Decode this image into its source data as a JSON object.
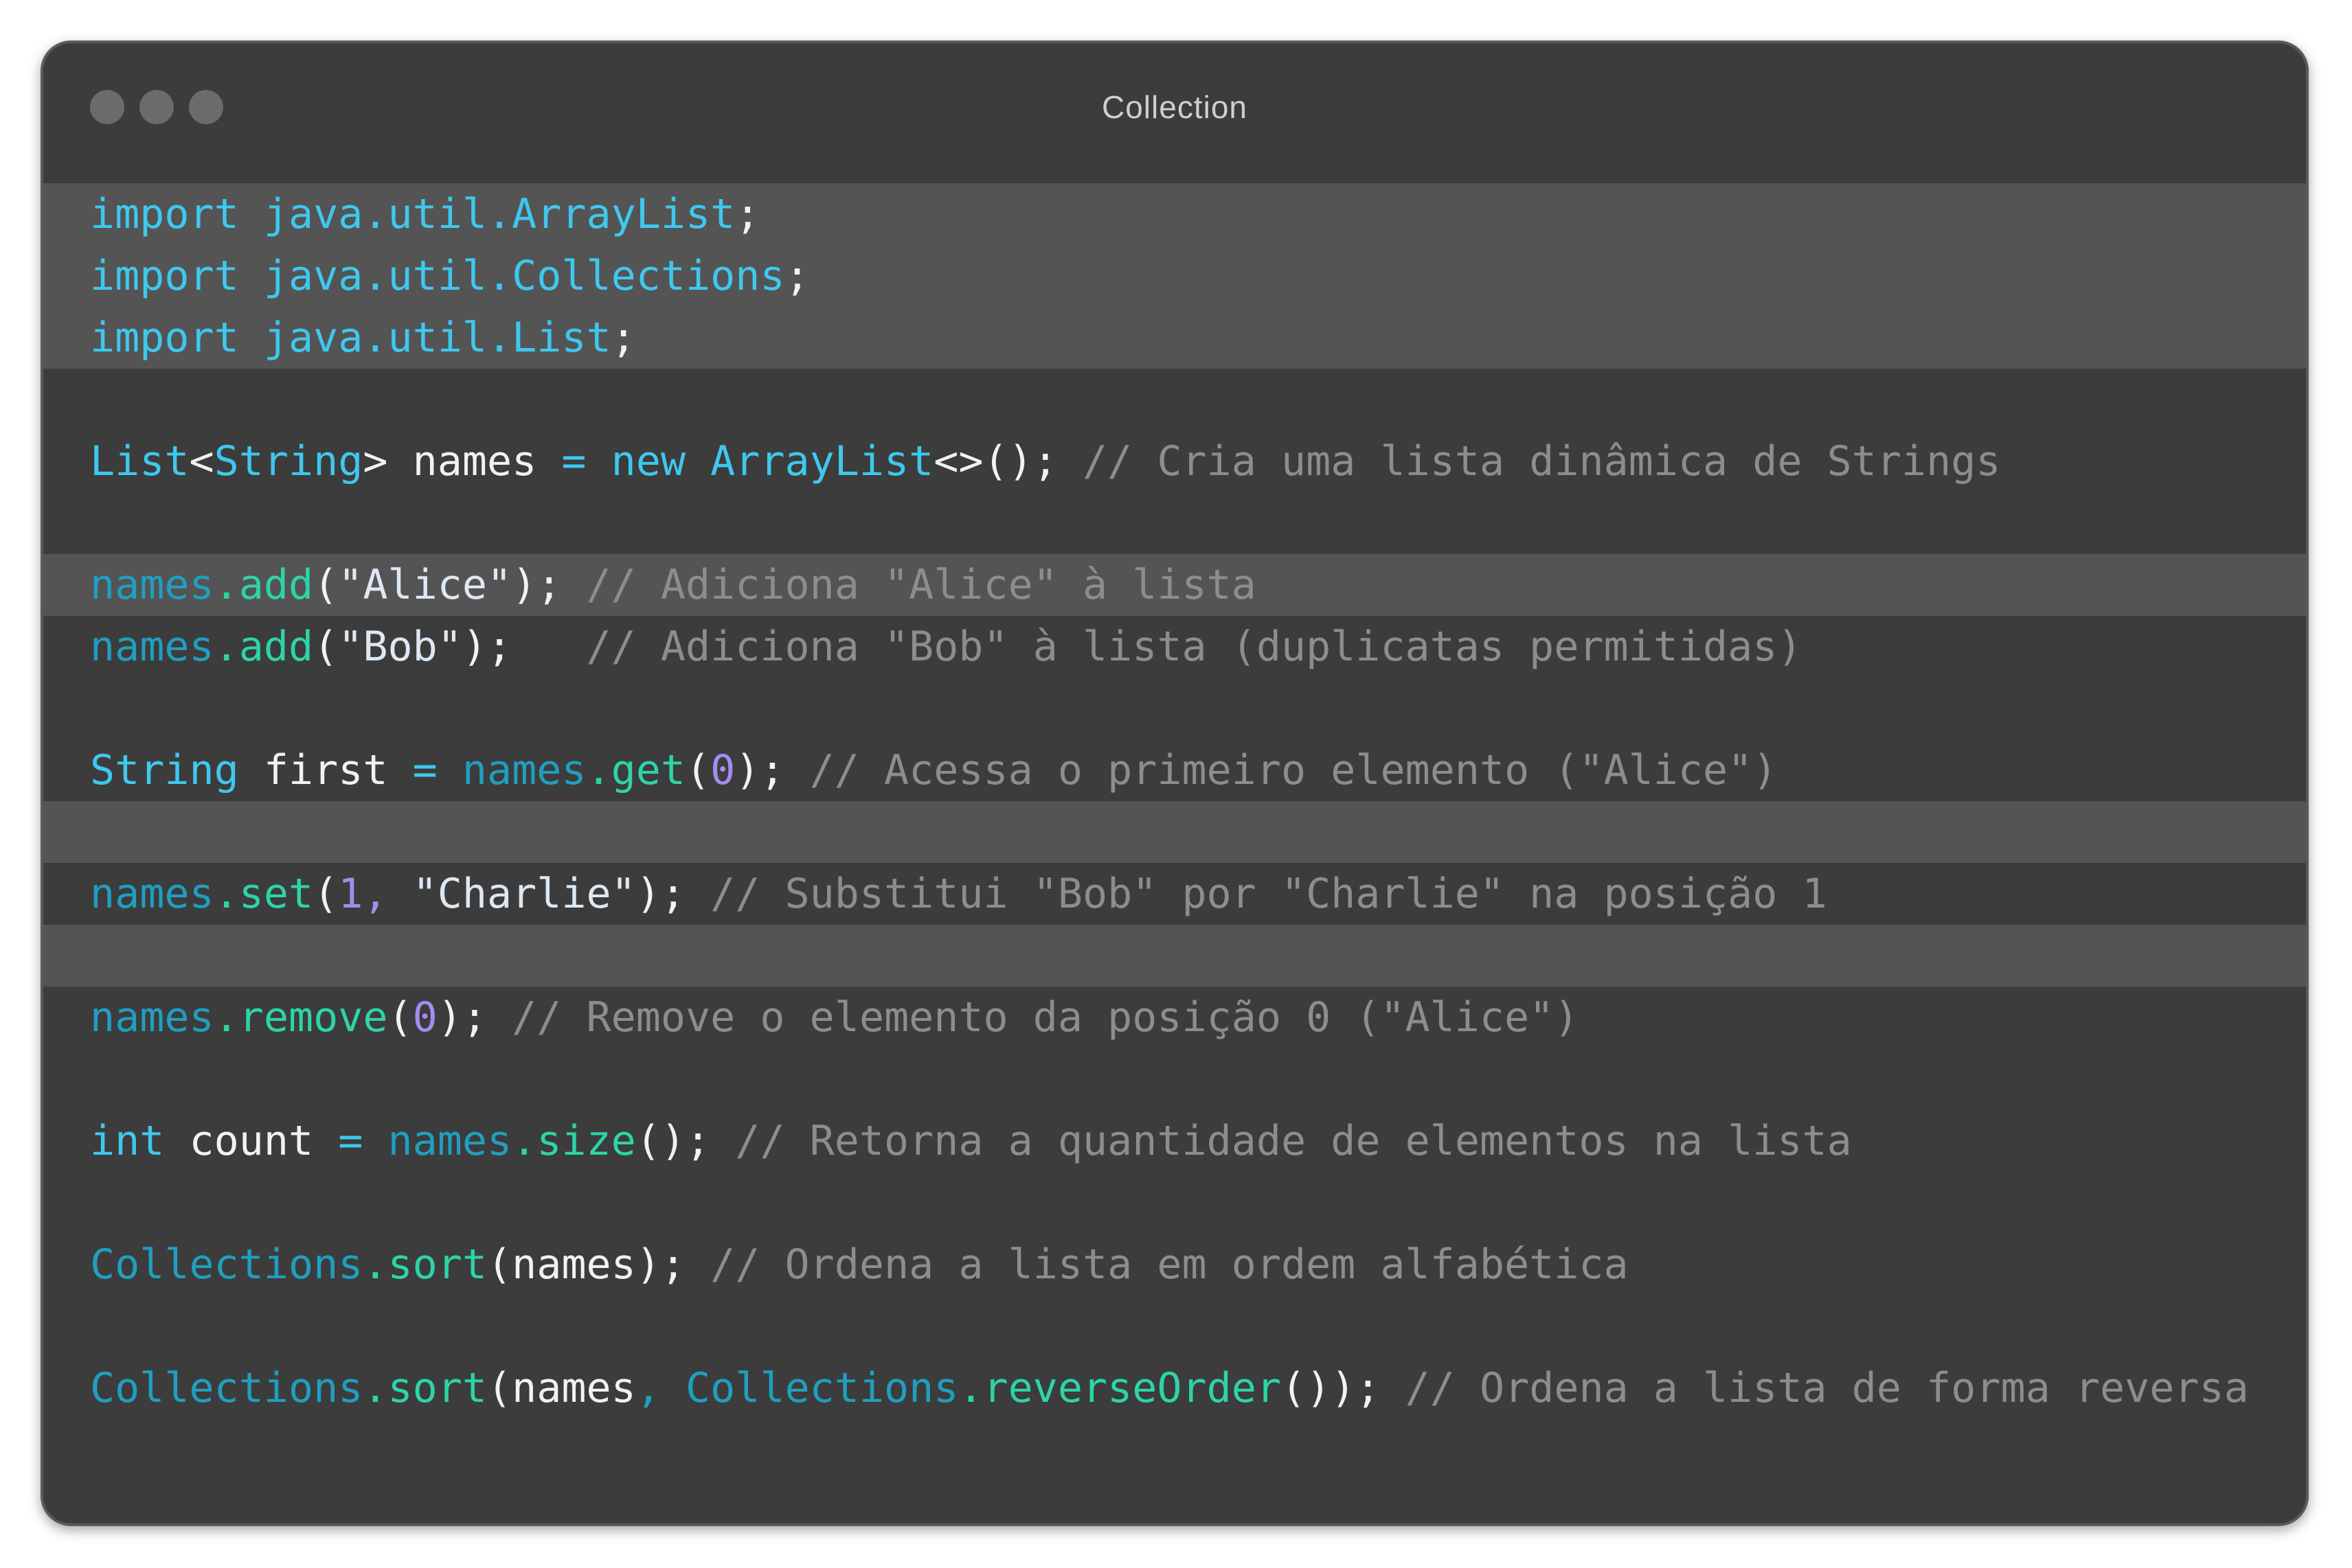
{
  "window": {
    "title": "Collection"
  },
  "colors": {
    "background": "#3c3c3c",
    "highlight": "#545454",
    "keyword": "#3ec8ef",
    "object": "#1f9fc0",
    "method": "#2dd4a8",
    "number": "#a48cf0",
    "comment": "#8d8d8d"
  },
  "code": {
    "imports": [
      {
        "kw": "import",
        "pkg": "java.util.ArrayList",
        "end": ";"
      },
      {
        "kw": "import",
        "pkg": "java.util.Collections",
        "end": ";"
      },
      {
        "kw": "import",
        "pkg": "java.util.List",
        "end": ";"
      }
    ],
    "decl": {
      "t1": "List",
      "lt": "<",
      "t2": "String",
      "gt": ">",
      "var": "names",
      "eq": "=",
      "new": "new",
      "cls": "ArrayList",
      "tail": "<>();",
      "comment": "// Cria uma lista dinâmica de Strings"
    },
    "add1": {
      "obj": "names",
      "dot": ".",
      "meth": "add",
      "open": "(",
      "arg": "\"Alice\"",
      "close": ");",
      "pad": " ",
      "comment": "// Adiciona \"Alice\" à lista"
    },
    "add2": {
      "obj": "names",
      "dot": ".",
      "meth": "add",
      "open": "(",
      "arg": "\"Bob\"",
      "close": ");",
      "pad": "   ",
      "comment": "// Adiciona \"Bob\" à lista (duplicatas permitidas)"
    },
    "get": {
      "type": "String",
      "var": "first",
      "eq": "=",
      "obj": "names",
      "dot": ".",
      "meth": "get",
      "open": "(",
      "num": "0",
      "close": ");",
      "comment": "// Acessa o primeiro elemento (\"Alice\")"
    },
    "set": {
      "obj": "names",
      "dot": ".",
      "meth": "set",
      "open": "(",
      "num": "1",
      "comma": ",",
      "arg": "\"Charlie\"",
      "close": ");",
      "comment": "// Substitui \"Bob\" por \"Charlie\" na posição 1"
    },
    "remove": {
      "obj": "names",
      "dot": ".",
      "meth": "remove",
      "open": "(",
      "num": "0",
      "close": ");",
      "comment": "// Remove o elemento da posição 0 (\"Alice\")"
    },
    "size": {
      "type": "int",
      "var": "count",
      "eq": "=",
      "obj": "names",
      "dot": ".",
      "meth": "size",
      "call": "();",
      "comment": "// Retorna a quantidade de elementos na lista"
    },
    "sort": {
      "obj": "Collections",
      "dot": ".",
      "meth": "sort",
      "open": "(",
      "arg": "names",
      "close": ");",
      "comment": "// Ordena a lista em ordem alfabética"
    },
    "sortrev": {
      "obj": "Collections",
      "dot": ".",
      "meth": "sort",
      "open": "(",
      "arg": "names",
      "comma": ",",
      "obj2": "Collections",
      "dot2": ".",
      "meth2": "reverseOrder",
      "close": "());",
      "comment": "// Ordena a lista de forma reversa"
    }
  }
}
